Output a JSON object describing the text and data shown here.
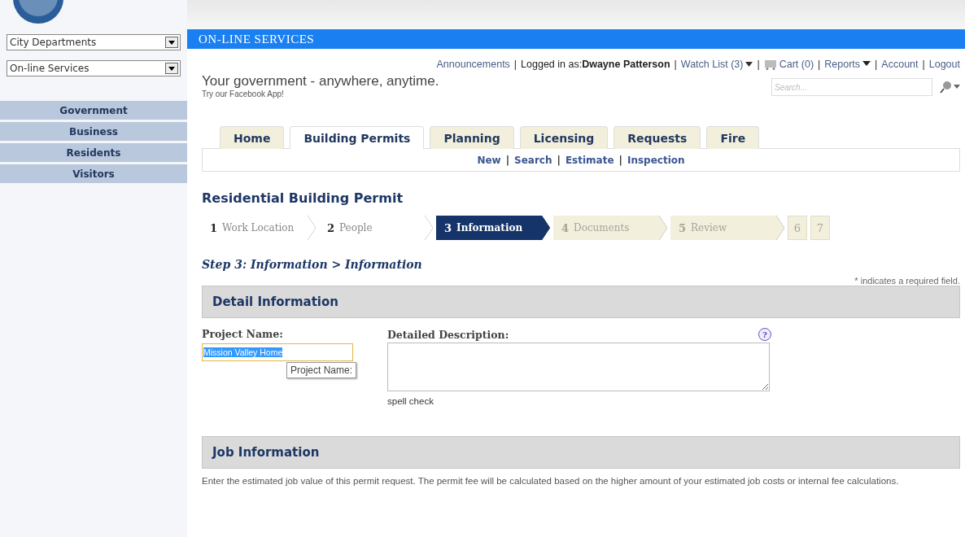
{
  "sidebar": {
    "dropdowns": [
      {
        "value": "City Departments"
      },
      {
        "value": "On-line Services"
      }
    ],
    "items": [
      {
        "label": "Government",
        "selected": false
      },
      {
        "label": "Business",
        "selected": false
      },
      {
        "label": "Residents",
        "selected": false
      },
      {
        "label": "Visitors",
        "selected": false
      }
    ]
  },
  "banner": {
    "title": "ON-LINE SERVICES"
  },
  "user_bar": {
    "announcements": "Announcements",
    "logged_in_label": "Logged in as:",
    "user": "Dwayne Patterson",
    "watch_list": "Watch List (3)",
    "cart": "Cart (0)",
    "reports": "Reports",
    "account": "Account",
    "logout": "Logout",
    "separator": "|"
  },
  "tagline": "Your government - anywhere, anytime.",
  "facebook_link": "Try our Facebook App!",
  "search": {
    "placeholder": "Search..."
  },
  "tabs": [
    {
      "label": "Home",
      "selected": false
    },
    {
      "label": "Building Permits",
      "selected": true
    },
    {
      "label": "Planning",
      "selected": false
    },
    {
      "label": "Licensing",
      "selected": false
    },
    {
      "label": "Requests",
      "selected": false
    },
    {
      "label": "Fire",
      "selected": false
    }
  ],
  "subnav": [
    "New",
    "Search",
    "Estimate",
    "Inspection"
  ],
  "page_title": "Residential Building Permit",
  "steps": [
    {
      "number": "1",
      "label": "Work Location",
      "completed": true,
      "selected": false
    },
    {
      "number": "2",
      "label": "People",
      "completed": true,
      "selected": false
    },
    {
      "number": "3",
      "label": "Information",
      "completed": false,
      "selected": true
    },
    {
      "number": "4",
      "label": "Documents",
      "completed": false,
      "selected": false
    },
    {
      "number": "5",
      "label": "Review",
      "completed": false,
      "selected": false
    },
    {
      "number": "6",
      "completed": false,
      "selected": false
    },
    {
      "number": "7",
      "completed": false,
      "selected": false
    }
  ],
  "step_heading": "Step 3: Information > Information",
  "required_note": "* indicates a required field.",
  "detail_section": {
    "title": "Detail Information",
    "project_label": "Project Name:",
    "project_value": "Mission Valley Home",
    "tooltip": "Project Name:",
    "description_label": "Detailed Description:",
    "help": "?",
    "spell_check": "spell check"
  },
  "job_section": {
    "title": "Job Information",
    "text": "Enter the estimated job value of this permit request.  The permit fee will be calculated based on the higher amount of your estimated job costs or internal fee calculations."
  }
}
